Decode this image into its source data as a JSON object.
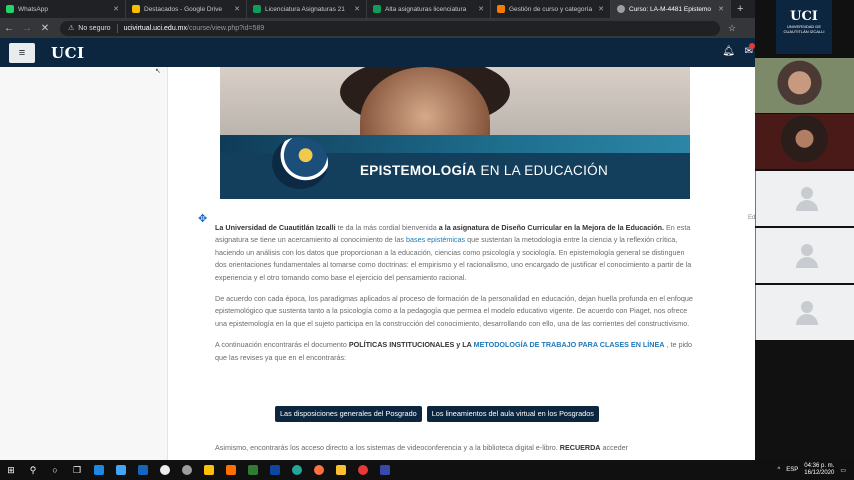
{
  "browser": {
    "tabs": [
      {
        "label": "WhatsApp",
        "color": "#25d366"
      },
      {
        "label": "Destacados - Google Drive",
        "color": "#fbbc04"
      },
      {
        "label": "Licenciatura Asignaturas 21",
        "color": "#0f9d58"
      },
      {
        "label": "Alta asignaturas licenciatura",
        "color": "#0f9d58"
      },
      {
        "label": "Gestión de curso y categoría",
        "color": "#f57c00"
      },
      {
        "label": "Curso: LA-M-4481 Epistemo",
        "color": "#9e9e9e",
        "active": true
      }
    ],
    "new_tab": "+",
    "address": {
      "security": "No seguro",
      "host": "ucivirtual.uci.edu.mx",
      "path": "/course/view.php?id=589"
    }
  },
  "navbar": {
    "menu_icon": "≡",
    "logo": "UCI"
  },
  "banner": {
    "title_bold": "EPISTEMOLOGÍA",
    "title_rest": " EN LA EDUCACIÓN"
  },
  "edit_hint": "Ed",
  "summary": {
    "p1": {
      "a": "La Universidad de Cuautitlán Izcalli",
      "b": " te da la más cordial bienvenida ",
      "c": "a la asignatura de Diseño Curricular en la Mejora de la Educación.",
      "d": " En esta asignatura se tiene un acercamiento al conocimiento de las ",
      "e": "bases epistémicas",
      "f": " que sustentan la metodología entre la ciencia y la reflexión crítica, haciendo un análisis con los datos que proporcionan a la educación, ciencias como psicología y sociología. En epistemología general se distinguen dos orientaciones fundamentales al tomarse como doctrinas: el empirismo y el racionalismo, uno encargado de justificar el conocimiento a partir de la experiencia y el otro tomando como base el ejercicio del pensamiento racional."
    },
    "p2": "De acuerdo con cada época, los paradigmas aplicados al proceso de formación de la personalidad en educación, dejan huella profunda en el enfoque epistemológico que sustenta tanto a la psicología como a la pedagogía que permea el modelo educativo vigente. De acuerdo con Piaget, nos ofrece una epistemología en la que el sujeto participa en la construcción del conocimiento, desarrollando con ello, una de las corrientes del constructivismo.",
    "p3": {
      "a": "A continuación encontrarás el documento ",
      "b": "POLÍTICAS INSTITUCIONALES",
      "c": " y LA ",
      "d": "METODOLOGÍA DE TRABAJO PARA CLASES EN LÍNEA",
      "e": " , te pido que las revises ya que en el encontrarás:"
    }
  },
  "buttons": {
    "left": "Las disposiciones generales del Posgrado",
    "right": "Los lineamientos del aula virtual en los Posgrados"
  },
  "tail": {
    "a": "Asimismo, encontrarás los acceso directo a los sistemas de videoconferencia y a la biblioteca digital e-libro. ",
    "b": "RECUERDA",
    "c": " acceder"
  },
  "side_logo": {
    "name": "UCI",
    "line1": "UNIVERSIDAD DE",
    "line2": "CUAUTITLÁN IZCALLI"
  },
  "taskbar": {
    "lang": "ESP",
    "time": "04:36 p. m.",
    "date": "16/12/2020"
  }
}
